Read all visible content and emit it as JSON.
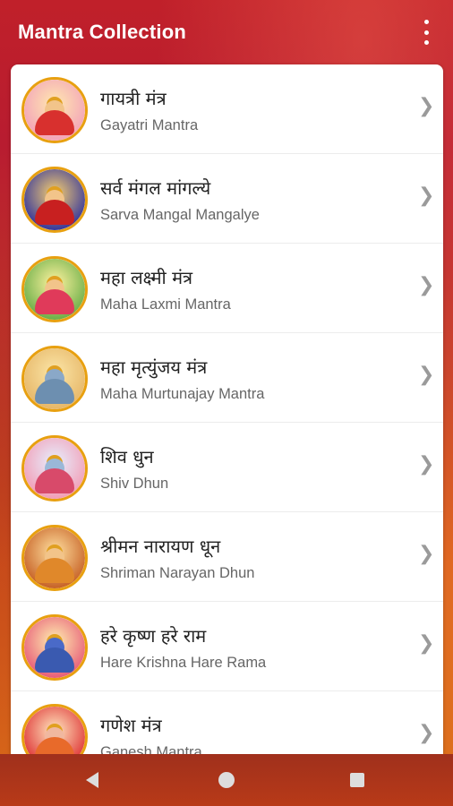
{
  "appbar": {
    "title": "Mantra Collection",
    "menu_icon": "more-vert-icon"
  },
  "colors": {
    "accent_red": "#c0202a",
    "accent_orange": "#d86a18",
    "avatar_ring": "#e8a010"
  },
  "mantras": [
    {
      "title_hi": "गायत्री मंत्र",
      "title_en": "Gayatri Mantra"
    },
    {
      "title_hi": "सर्व मंगल मांगल्ये",
      "title_en": "Sarva Mangal Mangalye"
    },
    {
      "title_hi": "महा लक्ष्मी मंत्र",
      "title_en": "Maha Laxmi Mantra"
    },
    {
      "title_hi": "महा मृत्युंजय मंत्र",
      "title_en": "Maha Murtunajay Mantra"
    },
    {
      "title_hi": "शिव धुन",
      "title_en": "Shiv Dhun"
    },
    {
      "title_hi": "श्रीमन नारायण धून",
      "title_en": "Shriman Narayan Dhun"
    },
    {
      "title_hi": "हरे कृष्ण हरे राम",
      "title_en": "Hare Krishna Hare Rama"
    },
    {
      "title_hi": "गणेश मंत्र",
      "title_en": "Ganesh Mantra"
    }
  ],
  "chevron": "❯",
  "navbar": {
    "back_icon": "back-icon",
    "home_icon": "home-icon",
    "recents_icon": "recents-icon"
  }
}
